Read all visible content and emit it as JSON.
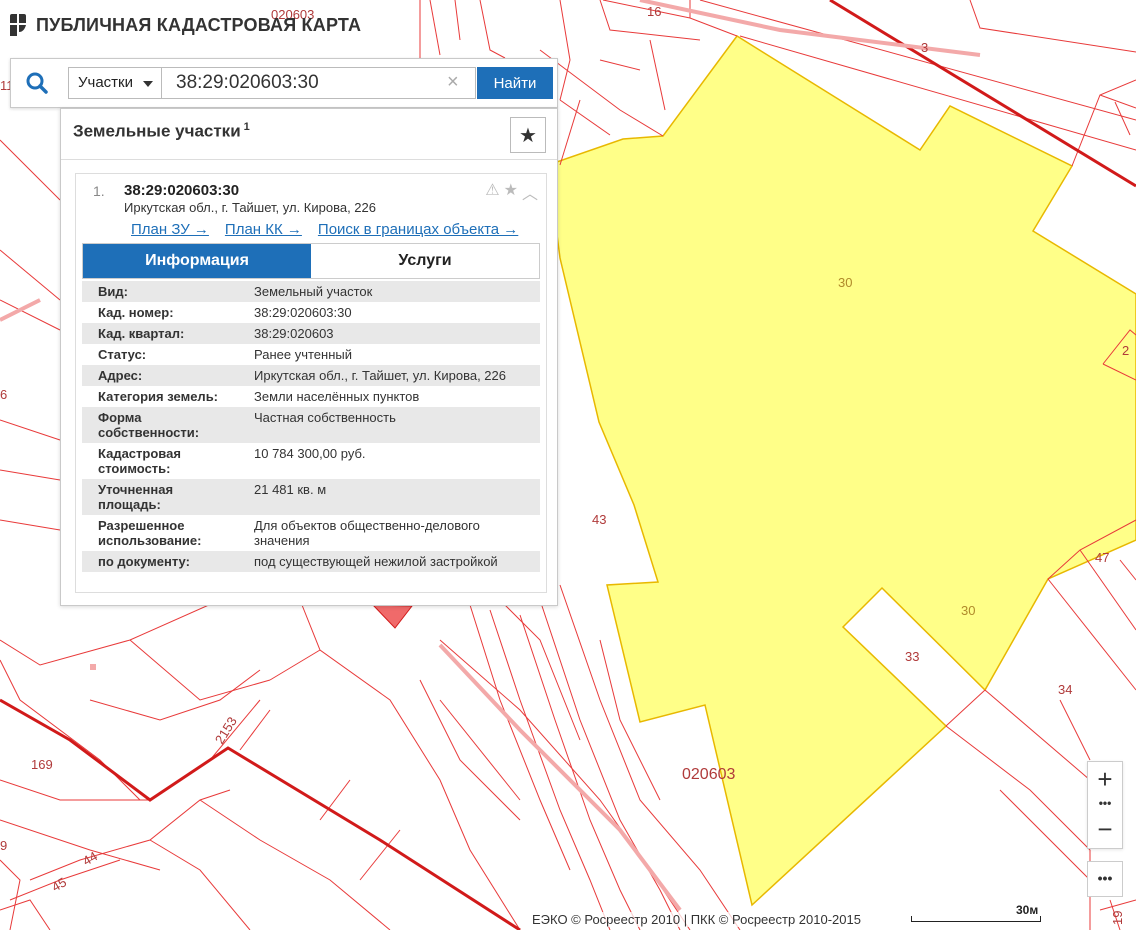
{
  "brand": {
    "title": "ПУБЛИЧНАЯ КАДАСТРОВАЯ КАРТА"
  },
  "search": {
    "type_label": "Участки",
    "query": "38:29:020603:30",
    "clear_glyph": "×",
    "find_label": "Найти"
  },
  "panel": {
    "header": "Земельные участки",
    "header_count": "1",
    "fav_glyph": "★",
    "card": {
      "index": "1.",
      "cadnum": "38:29:020603:30",
      "address": "Иркутская обл., г. Тайшет, ул. Кирова, 226",
      "actions": [
        "⚠",
        "★",
        "︿"
      ],
      "links": [
        "План ЗУ →",
        "План КК →",
        "Поиск в границах объекта →"
      ],
      "tabs": [
        "Информация",
        "Услуги"
      ],
      "info": [
        {
          "key": "Вид:",
          "value": "Земельный участок"
        },
        {
          "key": "Кад. номер:",
          "value": "38:29:020603:30",
          "link": true
        },
        {
          "key": "Кад. квартал:",
          "value": "38:29:020603",
          "link": true
        },
        {
          "key": "Статус:",
          "value": "Ранее учтенный"
        },
        {
          "key": "Адрес:",
          "value": "Иркутская обл., г. Тайшет, ул. Кирова, 226"
        },
        {
          "key": "Категория земель:",
          "value": "Земли населённых пунктов"
        },
        {
          "key": "Форма собственности:",
          "value": "Частная собственность"
        },
        {
          "key": "Кадастровая стоимость:",
          "value": "10 784 300,00 руб."
        },
        {
          "key": "Уточненная площадь:",
          "value": "21 481 кв. м"
        },
        {
          "key": "Разрешенное использование:",
          "value": "Для объектов общественно-делового значения"
        },
        {
          "key": "по документу:",
          "value": "под существующей нежилой застройкой"
        }
      ]
    }
  },
  "map": {
    "labels": {
      "q_top": "020603",
      "q_bottom": "020603",
      "p16": "16",
      "p3": "3",
      "p30a": "30",
      "p30b": "30",
      "p2": "2",
      "p43": "43",
      "p47": "47",
      "p33": "33",
      "p34": "34",
      "p169": "169",
      "p2153": "2153",
      "p44": "44",
      "p45": "45",
      "p6": "6",
      "p11": "11",
      "p19": "19",
      "p9": "9"
    },
    "highlight_color": "#ffff88",
    "boundary_color": "#e83a3a"
  },
  "controls": {
    "zoom_in": "+",
    "zoom_dots": "•••",
    "zoom_out": "−",
    "more": "•••"
  },
  "footer": {
    "attribution": "ЕЭКО © Росреестр 2010 | ПКК © Росреестр 2010-2015",
    "scale": "30м"
  }
}
